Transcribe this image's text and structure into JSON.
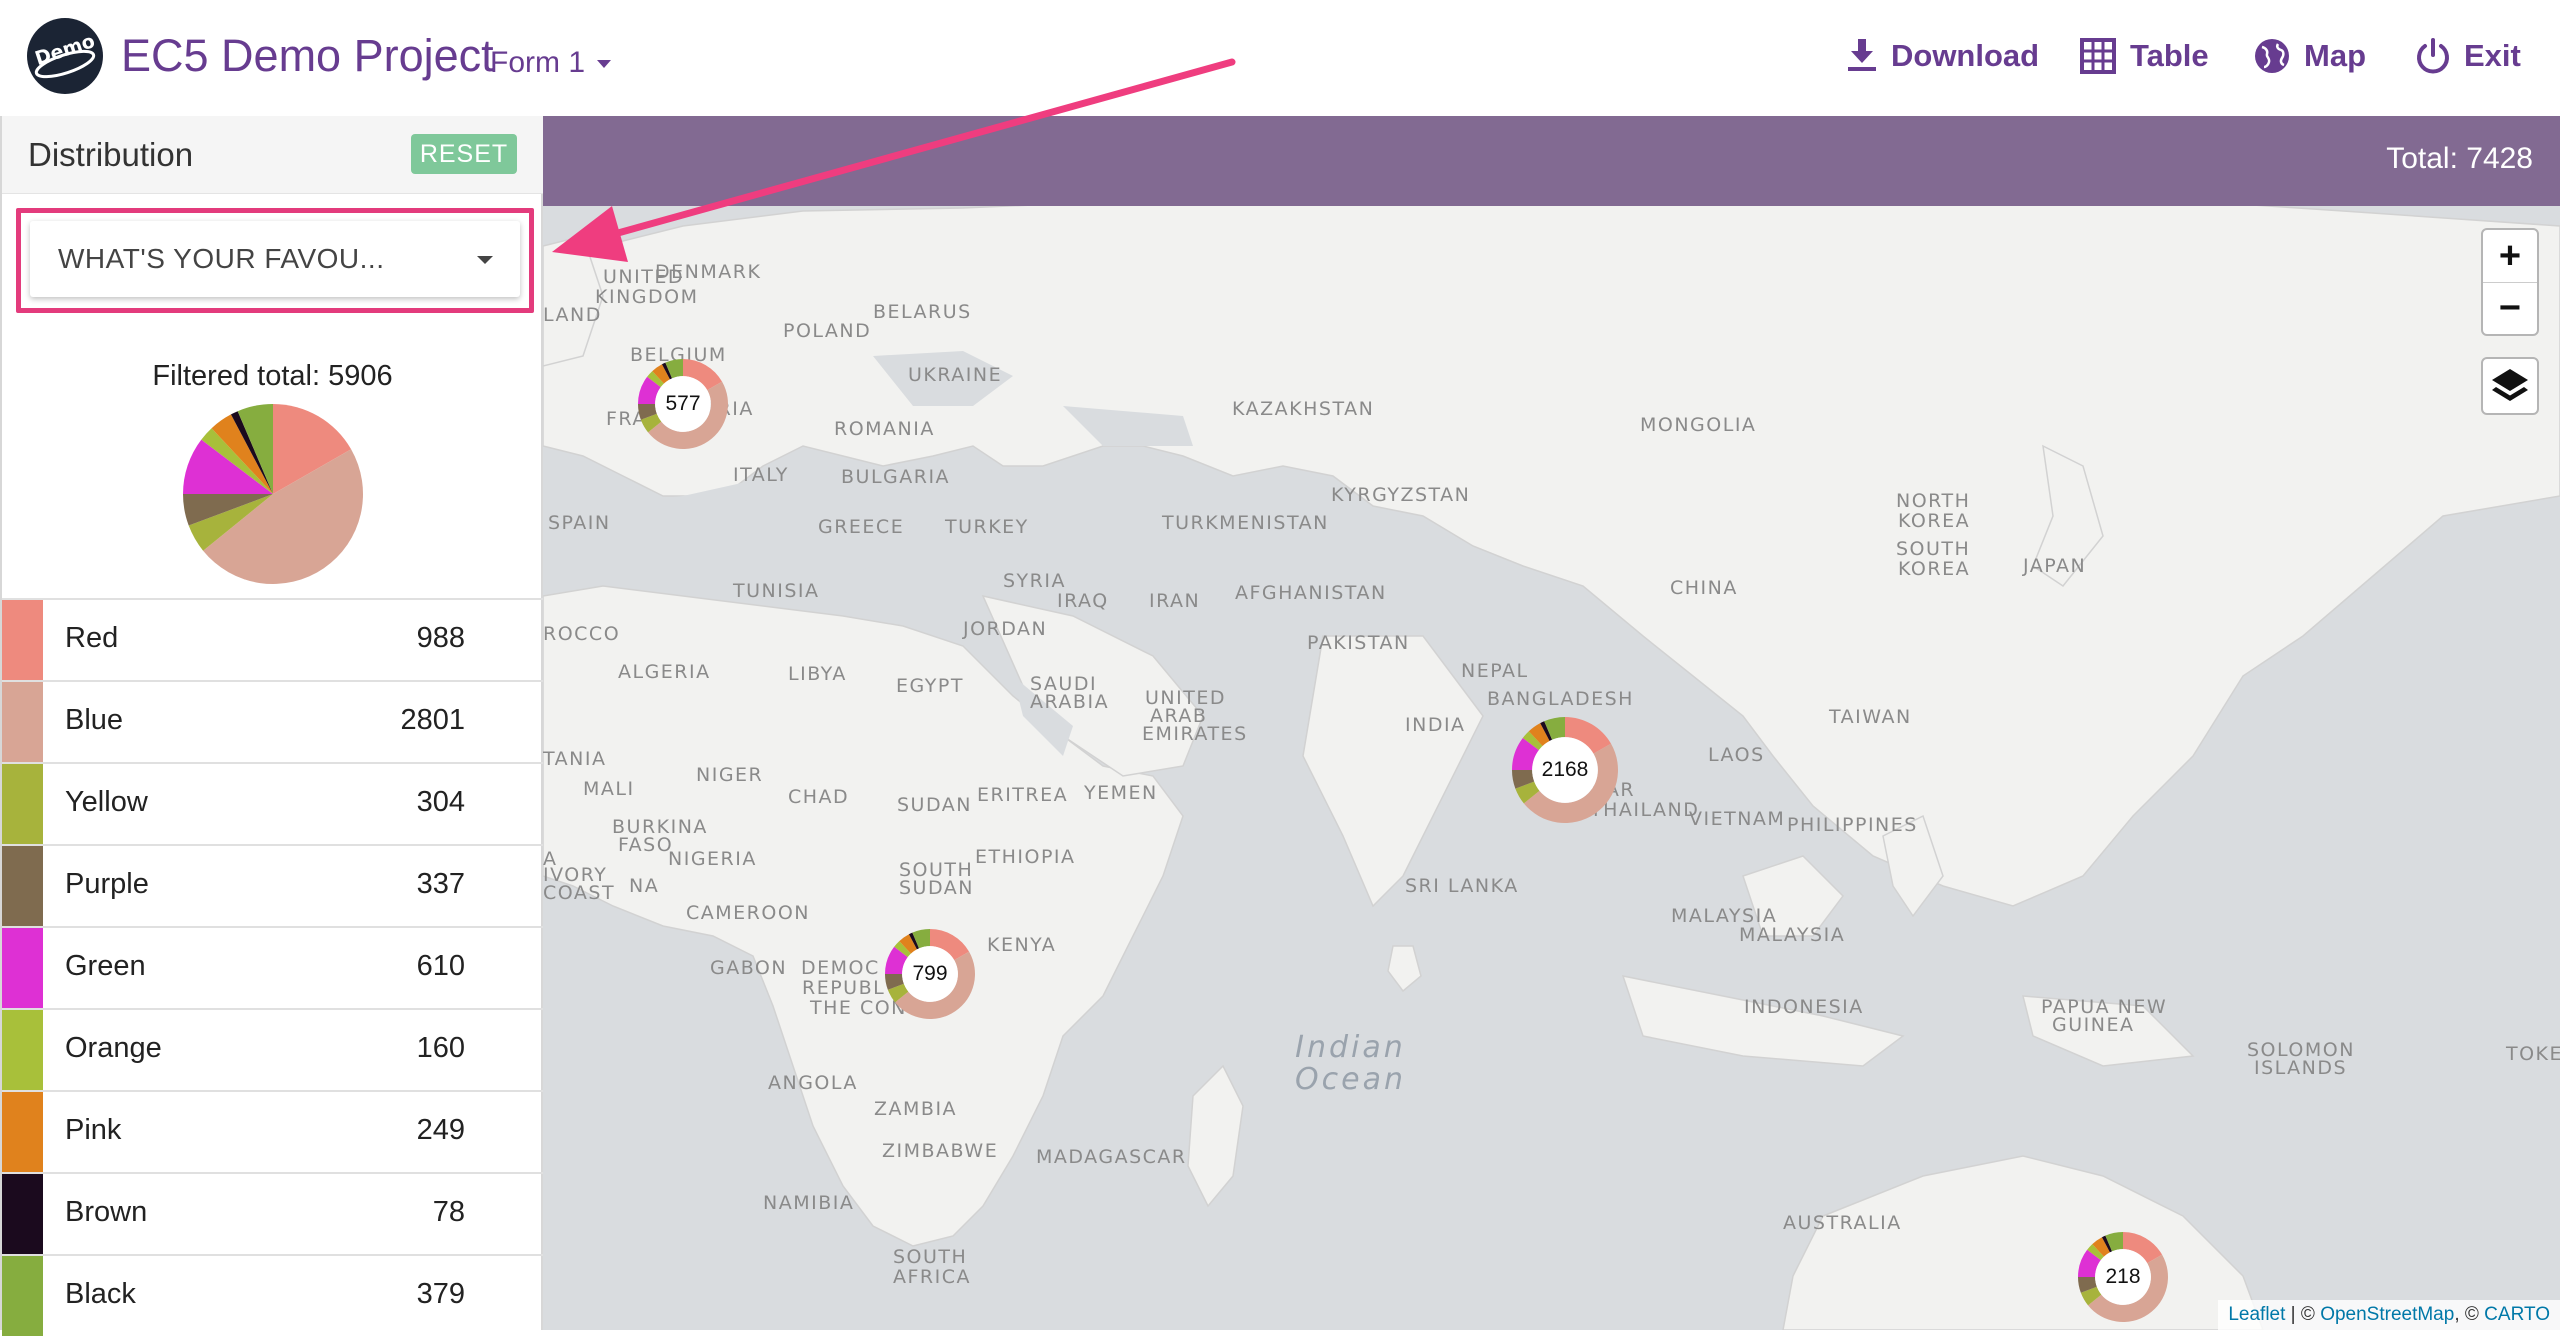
{
  "header": {
    "logo_text": "Demo",
    "title": "EC5 Demo Project",
    "form_selector": "Form 1",
    "nav": [
      {
        "label": "Download",
        "icon": "download-icon"
      },
      {
        "label": "Table",
        "icon": "table-icon"
      },
      {
        "label": "Map",
        "icon": "globe-icon"
      },
      {
        "label": "Exit",
        "icon": "power-icon"
      }
    ]
  },
  "sidebar": {
    "title": "Distribution",
    "reset_label": "RESET",
    "question_selected": "WHAT'S YOUR FAVOU...",
    "filtered_total_label": "Filtered total: 5906",
    "legend": [
      {
        "label": "Red",
        "count": "988",
        "color": "#ee8a7e"
      },
      {
        "label": "Blue",
        "count": "2801",
        "color": "#d8a595"
      },
      {
        "label": "Yellow",
        "count": "304",
        "color": "#a7b33c"
      },
      {
        "label": "Purple",
        "count": "337",
        "color": "#7f6b4f"
      },
      {
        "label": "Green",
        "count": "610",
        "color": "#de30d4"
      },
      {
        "label": "Orange",
        "count": "160",
        "color": "#a8c03a"
      },
      {
        "label": "Pink",
        "count": "249",
        "color": "#e0821d"
      },
      {
        "label": "Brown",
        "count": "78",
        "color": "#1b0a1e"
      },
      {
        "label": "Black",
        "count": "379",
        "color": "#86ad3f"
      }
    ]
  },
  "map": {
    "total_label": "Total: 7428",
    "zoom_in": "+",
    "zoom_out": "−",
    "clusters": [
      "577",
      "2168",
      "799",
      "218"
    ],
    "labels": [
      "DENMARK",
      "UNITED",
      "KINGDOM",
      "LAND",
      "BELARUS",
      "POLAND",
      "BELGIUM",
      "UKRAINE",
      "FRA",
      "AUSTRIA",
      "ROMANIA",
      "ITALY",
      "BULGARIA",
      "SPAIN",
      "GREECE",
      "TURKEY",
      "KAZAKHSTAN",
      "MONGOLIA",
      "KYRGYZSTAN",
      "TURKMENISTAN",
      "NORTH",
      "KOREA",
      "SOUTH",
      "KOREA",
      "JAPAN",
      "CHINA",
      "TUNISIA",
      "SYRIA",
      "IRAQ",
      "IRAN",
      "AFGHANISTAN",
      "ROCCO",
      "JORDAN",
      "PAKISTAN",
      "ALGERIA",
      "LIBYA",
      "EGYPT",
      "SAUDI",
      "ARABIA",
      "UNITED",
      "ARAB",
      "EMIRATES",
      "NEPAL",
      "BANGLADESH",
      "INDIA",
      "TAIWAN",
      "TANIA",
      "MALI",
      "NIGER",
      "CHAD",
      "SUDAN",
      "ERITREA",
      "YEMEN",
      "LAOS",
      "MAR",
      "THAILAND",
      "VIETNAM",
      "PHILIPPINES",
      "BURKINA",
      "FASO",
      "NIGERIA",
      "ETHIOPIA",
      "SOUTH",
      "SUDAN",
      "A",
      "IVORY",
      "COAST",
      "NA",
      "SRI LANKA",
      "CAMEROON",
      "MALAYSIA",
      "MALAYSIA",
      "KENYA",
      "GABON",
      "DEMOC",
      "REPUBL",
      "THE CON",
      "INDONESIA",
      "PAPUA NEW",
      "GUINEA",
      "SOLOMON",
      "ISLANDS",
      "TOKE",
      "ANGOLA",
      "ZAMBIA",
      "MADAGASCAR",
      "ZIMBABWE",
      "NAMIBIA",
      "SOUTH",
      "AFRICA",
      "AUSTRALIA"
    ],
    "ocean": [
      "Indian",
      "Ocean"
    ],
    "attribution": {
      "leaflet": "Leaflet",
      "sep1": " | © ",
      "osm": "OpenStreetMap",
      "sep2": ", © ",
      "carto": "CARTO"
    }
  },
  "colors": {
    "brand_purple": "#673c90",
    "total_bar": "#826a92",
    "reset_green": "#7fc89a",
    "highlight_pink": "#e33b7c"
  }
}
